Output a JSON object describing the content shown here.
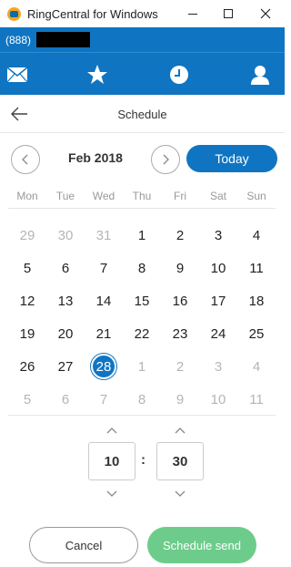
{
  "window": {
    "title": "RingCentral for Windows"
  },
  "header": {
    "phone_prefix": "(888)"
  },
  "nav": {
    "icons": [
      "envelope-icon",
      "star-icon",
      "clock-icon",
      "person-icon"
    ]
  },
  "page": {
    "title": "Schedule"
  },
  "calendar": {
    "month_label": "Feb 2018",
    "today_label": "Today",
    "weekdays": [
      "Mon",
      "Tue",
      "Wed",
      "Thu",
      "Fri",
      "Sat",
      "Sun"
    ],
    "days": [
      {
        "n": "29",
        "muted": true
      },
      {
        "n": "30",
        "muted": true
      },
      {
        "n": "31",
        "muted": true
      },
      {
        "n": "1"
      },
      {
        "n": "2"
      },
      {
        "n": "3"
      },
      {
        "n": "4"
      },
      {
        "n": "5"
      },
      {
        "n": "6"
      },
      {
        "n": "7"
      },
      {
        "n": "8"
      },
      {
        "n": "9"
      },
      {
        "n": "10"
      },
      {
        "n": "11"
      },
      {
        "n": "12"
      },
      {
        "n": "13"
      },
      {
        "n": "14"
      },
      {
        "n": "15"
      },
      {
        "n": "16"
      },
      {
        "n": "17"
      },
      {
        "n": "18"
      },
      {
        "n": "19"
      },
      {
        "n": "20"
      },
      {
        "n": "21"
      },
      {
        "n": "22"
      },
      {
        "n": "23"
      },
      {
        "n": "24"
      },
      {
        "n": "25"
      },
      {
        "n": "26"
      },
      {
        "n": "27"
      },
      {
        "n": "28",
        "selected": true
      },
      {
        "n": "1",
        "muted": true
      },
      {
        "n": "2",
        "muted": true
      },
      {
        "n": "3",
        "muted": true
      },
      {
        "n": "4",
        "muted": true
      },
      {
        "n": "5",
        "muted": true
      },
      {
        "n": "6",
        "muted": true
      },
      {
        "n": "7",
        "muted": true
      },
      {
        "n": "8",
        "muted": true
      },
      {
        "n": "9",
        "muted": true
      },
      {
        "n": "10",
        "muted": true
      },
      {
        "n": "11",
        "muted": true
      }
    ]
  },
  "time": {
    "hour": "10",
    "separator": ":",
    "minute": "30"
  },
  "footer": {
    "cancel_label": "Cancel",
    "send_label": "Schedule send"
  },
  "colors": {
    "brand_blue": "#0f75c2",
    "send_green": "#6dcc8b"
  }
}
